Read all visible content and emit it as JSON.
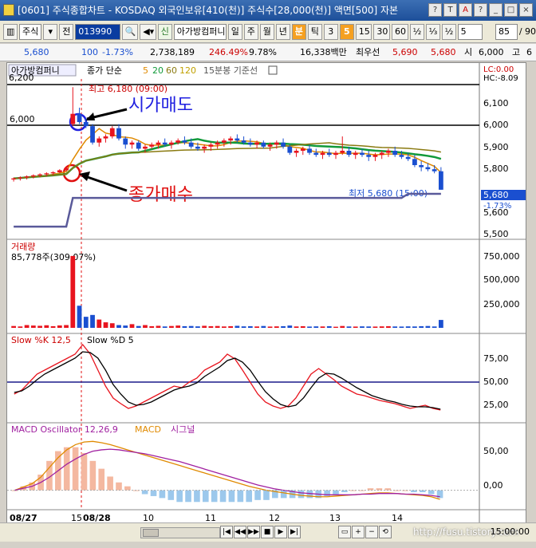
{
  "window": {
    "title": "[0601] 주식종합차트 - KOSDAQ 외국인보유[410(천)] 주식수[28,000(천)] 액면[500] 자본",
    "buttons": [
      "?",
      "T",
      "A",
      "?",
      "_",
      "□",
      "×"
    ]
  },
  "toolbar": {
    "market": "주식",
    "prev_label": "전",
    "code": "013990",
    "market_badge": "신",
    "stock_name": "아가방컴퍼니",
    "periods": [
      "일",
      "주",
      "월",
      "년",
      "분",
      "틱"
    ],
    "active_period": "분",
    "intervals": [
      "3",
      "5",
      "15",
      "30",
      "60",
      "½",
      "⅓",
      "½"
    ],
    "active_interval": "5",
    "interval_select": "5",
    "count": "85",
    "ratio": "/ 90"
  },
  "quote": {
    "price": "5,680",
    "change": "100",
    "change_rate": "-1.73%",
    "volume": "2,738,189",
    "vol_ratio": "246.49%",
    "turnover": "9.78%",
    "amount": "16,338백만",
    "best_label": "최우선",
    "ask": "5,690",
    "bid": "5,680",
    "open_label": "시",
    "open": "6,000",
    "high_label": "고",
    "high_trunc": "6"
  },
  "price_panel": {
    "stock_label": "아가방컴퍼니",
    "series_label": "종가 단순",
    "ma_periods": [
      "5",
      "20",
      "60",
      "120"
    ],
    "basis_label": "15분봉 기준선",
    "lc": "LC:0.00",
    "hc": "HC:-8.09",
    "left_top": "6,200",
    "left_ref": "6,000",
    "high_note": "최고 6,180 (09:00)",
    "low_note": "최저 5,680 (15:00)",
    "last_price": "5,680",
    "last_rate": "-1.73%",
    "annot_sell": "시가매도",
    "annot_buy": "종가매수",
    "y_ticks": [
      "6,100",
      "6,000",
      "5,900",
      "5,800",
      "5,700",
      "5,600",
      "5,500"
    ]
  },
  "volume_panel": {
    "title": "거래량",
    "value": "85,778주(309.07%)",
    "y_ticks": [
      "750,000",
      "500,000",
      "250,000"
    ]
  },
  "stoch_panel": {
    "title_k": "Slow %K 12,5",
    "title_d": "Slow %D 5",
    "y_ticks": [
      "75,00",
      "50,00",
      "25,00"
    ]
  },
  "macd_panel": {
    "title_osc": "MACD Oscillator 12,26,9",
    "title_macd": "MACD",
    "title_signal": "시그널",
    "y_ticks": [
      "50,00",
      "0,00"
    ]
  },
  "x_axis": {
    "labels": [
      "08/27",
      "15",
      "08/28",
      "10",
      "11",
      "12",
      "13",
      "14"
    ],
    "right_time": "15:00:00"
  },
  "watermark": "http://fusu.tistory.com",
  "colors": {
    "up": "#e8141e",
    "down": "#1a4fd0",
    "ma5": "#e08a00",
    "ma20": "#119a3a",
    "ma60": "#8a7a10",
    "basis": "#5a5a9a",
    "annot_blue": "#2020e0",
    "annot_red": "#e01010"
  },
  "chart_data": {
    "type": "candlestick",
    "price_range": [
      5450,
      6220
    ],
    "candles": [
      [
        5730,
        5740,
        5720,
        5735
      ],
      [
        5735,
        5745,
        5725,
        5740
      ],
      [
        5740,
        5750,
        5730,
        5745
      ],
      [
        5745,
        5755,
        5735,
        5750
      ],
      [
        5750,
        5760,
        5740,
        5755
      ],
      [
        5755,
        5765,
        5745,
        5760
      ],
      [
        5760,
        5770,
        5750,
        5765
      ],
      [
        5765,
        5780,
        5760,
        5775
      ],
      [
        5775,
        5790,
        5770,
        5785
      ],
      [
        6000,
        6180,
        5990,
        6050
      ],
      [
        6050,
        6080,
        6000,
        6010
      ],
      [
        6010,
        6030,
        5980,
        5990
      ],
      [
        5990,
        6000,
        5900,
        5910
      ],
      [
        5910,
        5940,
        5890,
        5930
      ],
      [
        5930,
        5950,
        5910,
        5940
      ],
      [
        5940,
        5990,
        5930,
        5980
      ],
      [
        5980,
        6000,
        5920,
        5930
      ],
      [
        5930,
        5940,
        5880,
        5900
      ],
      [
        5900,
        5920,
        5880,
        5910
      ],
      [
        5910,
        5920,
        5870,
        5880
      ],
      [
        5880,
        5900,
        5860,
        5890
      ],
      [
        5890,
        5910,
        5880,
        5900
      ],
      [
        5900,
        5920,
        5880,
        5910
      ],
      [
        5910,
        5930,
        5890,
        5900
      ],
      [
        5900,
        5920,
        5880,
        5910
      ],
      [
        5910,
        5930,
        5900,
        5920
      ],
      [
        5920,
        5940,
        5900,
        5910
      ],
      [
        5910,
        5930,
        5880,
        5890
      ],
      [
        5890,
        5910,
        5870,
        5880
      ],
      [
        5880,
        5900,
        5860,
        5890
      ],
      [
        5890,
        5910,
        5870,
        5900
      ],
      [
        5900,
        5920,
        5880,
        5910
      ],
      [
        5910,
        5930,
        5890,
        5920
      ],
      [
        5920,
        5940,
        5900,
        5930
      ],
      [
        5930,
        5950,
        5910,
        5920
      ],
      [
        5920,
        5940,
        5900,
        5910
      ],
      [
        5910,
        5930,
        5890,
        5900
      ],
      [
        5900,
        5920,
        5880,
        5910
      ],
      [
        5910,
        5920,
        5880,
        5890
      ],
      [
        5890,
        5910,
        5870,
        5900
      ],
      [
        5900,
        5920,
        5880,
        5910
      ],
      [
        5910,
        5930,
        5880,
        5890
      ],
      [
        5890,
        5900,
        5850,
        5860
      ],
      [
        5860,
        5880,
        5840,
        5870
      ],
      [
        5870,
        5890,
        5850,
        5880
      ],
      [
        5880,
        5900,
        5850,
        5860
      ],
      [
        5860,
        5880,
        5840,
        5850
      ],
      [
        5850,
        5870,
        5830,
        5860
      ],
      [
        5860,
        5880,
        5840,
        5850
      ],
      [
        5850,
        5870,
        5830,
        5860
      ],
      [
        5860,
        5940,
        5850,
        5870
      ],
      [
        5870,
        5890,
        5840,
        5850
      ],
      [
        5850,
        5870,
        5830,
        5860
      ],
      [
        5860,
        5880,
        5840,
        5850
      ],
      [
        5850,
        5870,
        5820,
        5840
      ],
      [
        5840,
        5860,
        5820,
        5850
      ],
      [
        5850,
        5870,
        5830,
        5860
      ],
      [
        5860,
        5880,
        5840,
        5870
      ],
      [
        5870,
        5890,
        5840,
        5850
      ],
      [
        5850,
        5870,
        5830,
        5840
      ],
      [
        5840,
        5860,
        5820,
        5830
      ],
      [
        5830,
        5850,
        5790,
        5800
      ],
      [
        5800,
        5820,
        5770,
        5790
      ],
      [
        5790,
        5810,
        5770,
        5780
      ],
      [
        5780,
        5800,
        5760,
        5770
      ],
      [
        5770,
        5790,
        5680,
        5680
      ]
    ],
    "volume": [
      20000,
      15000,
      30000,
      25000,
      22000,
      28000,
      18000,
      26000,
      30000,
      780000,
      240000,
      120000,
      140000,
      90000,
      60000,
      50000,
      30000,
      25000,
      40000,
      20000,
      30000,
      18000,
      22000,
      15000,
      20000,
      25000,
      18000,
      20000,
      16000,
      22000,
      18000,
      20000,
      15000,
      18000,
      22000,
      16000,
      18000,
      15000,
      20000,
      14000,
      16000,
      18000,
      25000,
      15000,
      18000,
      14000,
      16000,
      15000,
      18000,
      12000,
      20000,
      15000,
      14000,
      16000,
      15000,
      14000,
      16000,
      18000,
      15000,
      14000,
      16000,
      15000,
      18000,
      20000,
      15000,
      85778
    ],
    "volume_range": [
      0,
      900000
    ],
    "stoch_k": [
      30,
      35,
      45,
      55,
      60,
      65,
      70,
      75,
      80,
      92,
      80,
      60,
      40,
      25,
      18,
      12,
      15,
      20,
      25,
      30,
      35,
      40,
      38,
      45,
      50,
      60,
      65,
      70,
      80,
      74,
      60,
      45,
      30,
      20,
      15,
      12,
      15,
      25,
      40,
      55,
      62,
      55,
      48,
      40,
      35,
      30,
      28,
      25,
      22,
      20,
      18,
      15,
      12,
      14,
      16,
      12,
      10
    ],
    "stoch_d": [
      32,
      34,
      40,
      48,
      55,
      60,
      65,
      70,
      75,
      83,
      82,
      75,
      60,
      42,
      30,
      20,
      16,
      17,
      20,
      25,
      30,
      35,
      38,
      40,
      44,
      52,
      58,
      64,
      72,
      75,
      70,
      60,
      46,
      33,
      24,
      17,
      14,
      16,
      25,
      38,
      50,
      56,
      55,
      50,
      44,
      38,
      33,
      28,
      25,
      22,
      20,
      17,
      15,
      14,
      14,
      13,
      11
    ],
    "stoch_range": [
      0,
      100
    ],
    "macd": [
      0,
      5,
      10,
      20,
      35,
      50,
      62,
      70,
      74,
      75,
      73,
      70,
      66,
      62,
      58,
      54,
      50,
      46,
      42,
      38,
      34,
      30,
      26,
      22,
      18,
      14,
      10,
      6,
      3,
      0,
      -2,
      -4,
      -6,
      -8,
      -9,
      -10,
      -10,
      -9,
      -8,
      -7,
      -6,
      -5,
      -4,
      -4,
      -5,
      -6,
      -7,
      -8,
      -10,
      -14
    ],
    "signal": [
      0,
      3,
      6,
      12,
      20,
      30,
      40,
      48,
      55,
      60,
      62,
      63,
      62,
      60,
      58,
      56,
      53,
      50,
      47,
      44,
      40,
      36,
      32,
      28,
      24,
      20,
      16,
      12,
      8,
      5,
      2,
      0,
      -2,
      -4,
      -5,
      -6,
      -7,
      -7,
      -7,
      -7,
      -6,
      -6,
      -5,
      -5,
      -5,
      -6,
      -6,
      -7,
      -8,
      -10
    ],
    "macd_range": [
      -25,
      95
    ]
  }
}
